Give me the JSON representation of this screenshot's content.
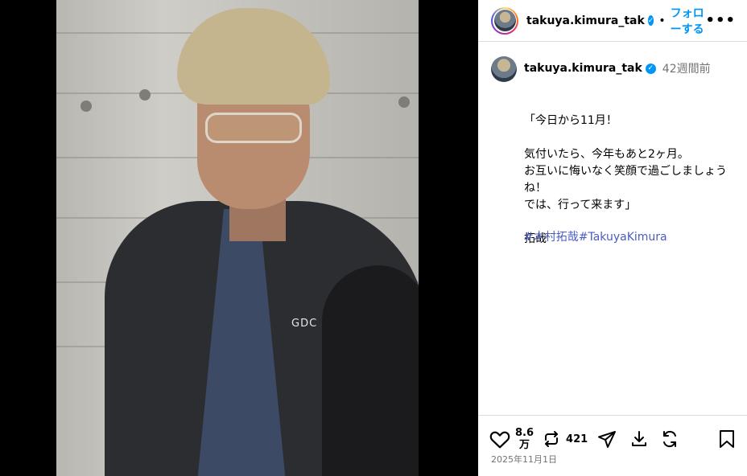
{
  "header": {
    "username": "takuya.kimura_tak",
    "separator": "•",
    "follow_label": "フォローする",
    "more_label": "•••"
  },
  "post": {
    "image_text": "GDC"
  },
  "comment": {
    "username": "takuya.kimura_tak",
    "time_ago": "42週間前",
    "caption": "「今日から11月！\n\n気付いたら、今年もあと2ヶ月。\nお互いに悔いなく笑顔で過ごしましょうね！\nでは、行って来ます」\n\n拓哉",
    "hashtags": [
      "#木村拓哉",
      "#TakuyaKimura"
    ]
  },
  "actions": {
    "likes_line1": "8.6",
    "likes_line2": "万",
    "reposts": "421",
    "date": "2025年11月1日"
  },
  "icons": {
    "verified": "verified-badge-icon",
    "like": "heart-icon",
    "repost": "repost-icon",
    "share": "send-icon",
    "download": "download-icon",
    "remix": "refresh-icon",
    "save": "bookmark-icon"
  },
  "colors": {
    "accent": "#0095f6",
    "hashtag": "#4a5dbf",
    "muted": "#737373"
  }
}
